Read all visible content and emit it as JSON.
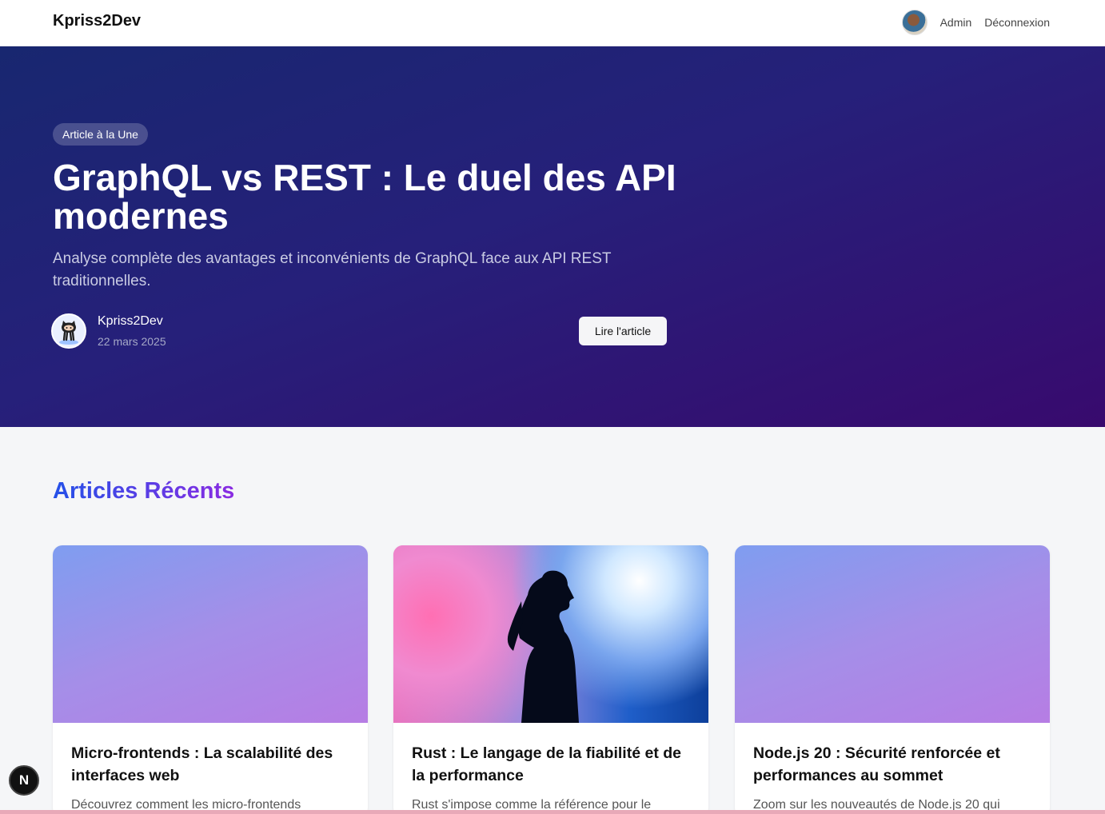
{
  "header": {
    "brand": "Kpriss2Dev",
    "avatar_icon": "user-avatar-icon",
    "admin_label": "Admin",
    "logout_label": "Déconnexion"
  },
  "hero": {
    "badge": "Article à la Une",
    "title": "GraphQL vs REST : Le duel des API modernes",
    "subtitle": "Analyse complète des avantages et inconvénients de GraphQL face aux API REST traditionnelles.",
    "author_name": "Kpriss2Dev",
    "author_avatar_icon": "github-octocat-icon",
    "date": "22 mars 2025",
    "read_button": "Lire l'article"
  },
  "recent": {
    "title": "Articles Récents",
    "cards": [
      {
        "title": "Micro-frontends : La scalabilité des interfaces web",
        "excerpt": "Découvrez comment les micro-frontends"
      },
      {
        "title": "Rust : Le langage de la fiabilité et de la performance",
        "excerpt": "Rust s'impose comme la référence pour le"
      },
      {
        "title": "Node.js 20 : Sécurité renforcée et performances au sommet",
        "excerpt": "Zoom sur les nouveautés de Node.js 20 qui"
      }
    ]
  },
  "dev_badge": "N",
  "colors": {
    "hero_start": "#182770",
    "hero_end": "#380a6e",
    "accent_blue": "#2451e8",
    "accent_purple": "#8a2be2"
  }
}
